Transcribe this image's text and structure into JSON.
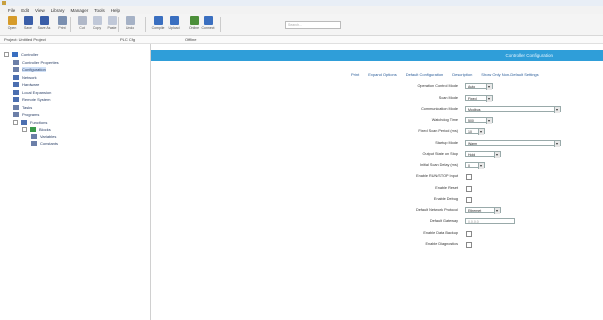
{
  "menu": [
    "File",
    "Edit",
    "View",
    "Library",
    "Manager",
    "Tools",
    "Help"
  ],
  "toolbar": [
    {
      "label": "Open",
      "icon": "folder-open-icon",
      "color": "#d69b2a"
    },
    {
      "label": "Save",
      "icon": "save-icon",
      "color": "#3a5ea8"
    },
    {
      "label": "Save As",
      "icon": "save-as-icon",
      "color": "#3a5ea8"
    },
    {
      "label": "Print",
      "icon": "print-icon",
      "color": "#7a8fb0"
    },
    {
      "label": "Cut",
      "icon": "cut-icon",
      "color": "#b0b8c8"
    },
    {
      "label": "Copy",
      "icon": "copy-icon",
      "color": "#c0c8d8"
    },
    {
      "label": "Paste",
      "icon": "paste-icon",
      "color": "#c0c8d8"
    },
    {
      "label": "Undo",
      "icon": "undo-icon",
      "color": "#a6b2c6"
    },
    {
      "label": "Compile",
      "icon": "compile-icon",
      "color": "#3a6fc0"
    },
    {
      "label": "Upload",
      "icon": "upload-icon",
      "color": "#3a6fc0"
    },
    {
      "label": "Online",
      "icon": "online-icon",
      "color": "#4c8f3a"
    },
    {
      "label": "Connect",
      "icon": "connect-icon",
      "color": "#3a6fc0"
    }
  ],
  "search": {
    "placeholder": "Search..."
  },
  "subbar": {
    "project": "Project: Untitled Project",
    "tag": "PLC Cfg",
    "mode": "Offline"
  },
  "tree": [
    {
      "label": "Controller",
      "icon": "controller-icon",
      "color": "#3a6fc0",
      "level": 0
    },
    {
      "label": "Controller Properties",
      "icon": "properties-icon",
      "color": "#6c7fa8",
      "level": 1
    },
    {
      "label": "Configuration",
      "icon": "gear-icon",
      "color": "#6c7fa8",
      "level": 1,
      "selected": true
    },
    {
      "label": "Network",
      "icon": "network-icon",
      "color": "#4c6fb0",
      "level": 1
    },
    {
      "label": "Hardware",
      "icon": "hardware-icon",
      "color": "#4c6fb0",
      "level": 1
    },
    {
      "label": "Local Expansion",
      "icon": "expansion-icon",
      "color": "#4c6fb0",
      "level": 1
    },
    {
      "label": "Remote System",
      "icon": "remote-icon",
      "color": "#4c6fb0",
      "level": 1
    },
    {
      "label": "Tasks",
      "icon": "task-icon",
      "color": "#6c7fa8",
      "level": 1
    },
    {
      "label": "Programs",
      "icon": "program-icon",
      "color": "#6c7fa8",
      "level": 1
    },
    {
      "label": "Functions",
      "icon": "function-icon",
      "color": "#4c6fb0",
      "level": 1
    },
    {
      "label": "Blocks",
      "icon": "block-icon",
      "color": "#3a9a4a",
      "level": 2
    },
    {
      "label": "Variables",
      "icon": "variable-icon",
      "color": "#6c7fa8",
      "level": 3
    },
    {
      "label": "Constants",
      "icon": "constant-icon",
      "color": "#6c7fa8",
      "level": 3
    }
  ],
  "main": {
    "header": "Controller Configuration",
    "links": [
      "Print",
      "Expand Options",
      "Default Configuration",
      "Description",
      "Show Only Non-Default Settings"
    ]
  },
  "fields": [
    {
      "label": "Operation Control Mode",
      "type": "select",
      "value": "Auto",
      "w": 22
    },
    {
      "label": "Scan Mode",
      "type": "select",
      "value": "Fixed",
      "w": 22
    },
    {
      "label": "Communication Mode",
      "type": "select",
      "value": "Modbus",
      "w": 90
    },
    {
      "label": "Watchdog Time",
      "type": "select",
      "value": "500",
      "w": 22
    },
    {
      "label": "Fixed Scan Period (ms)",
      "type": "select",
      "value": "10",
      "w": 14
    },
    {
      "label": "Startup Mode",
      "type": "select",
      "value": "Warm",
      "w": 90
    },
    {
      "label": "Output State on Stop",
      "type": "select",
      "value": "Hold",
      "w": 30
    },
    {
      "label": "Initial Scan Delay (ms)",
      "type": "select",
      "value": "0",
      "w": 14
    },
    {
      "label": "Enable RUN/STOP Input",
      "type": "check"
    },
    {
      "label": "Enable Reset",
      "type": "check"
    },
    {
      "label": "Enable Debug",
      "type": "check"
    },
    {
      "label": "Default Network Protocol",
      "type": "select",
      "value": "Ethernet",
      "w": 30
    },
    {
      "label": "Default Gateway",
      "type": "text",
      "value": "0.0.0.0",
      "w": 50
    },
    {
      "label": "Enable Data Backup",
      "type": "check"
    },
    {
      "label": "Enable Diagnostics",
      "type": "check"
    }
  ]
}
